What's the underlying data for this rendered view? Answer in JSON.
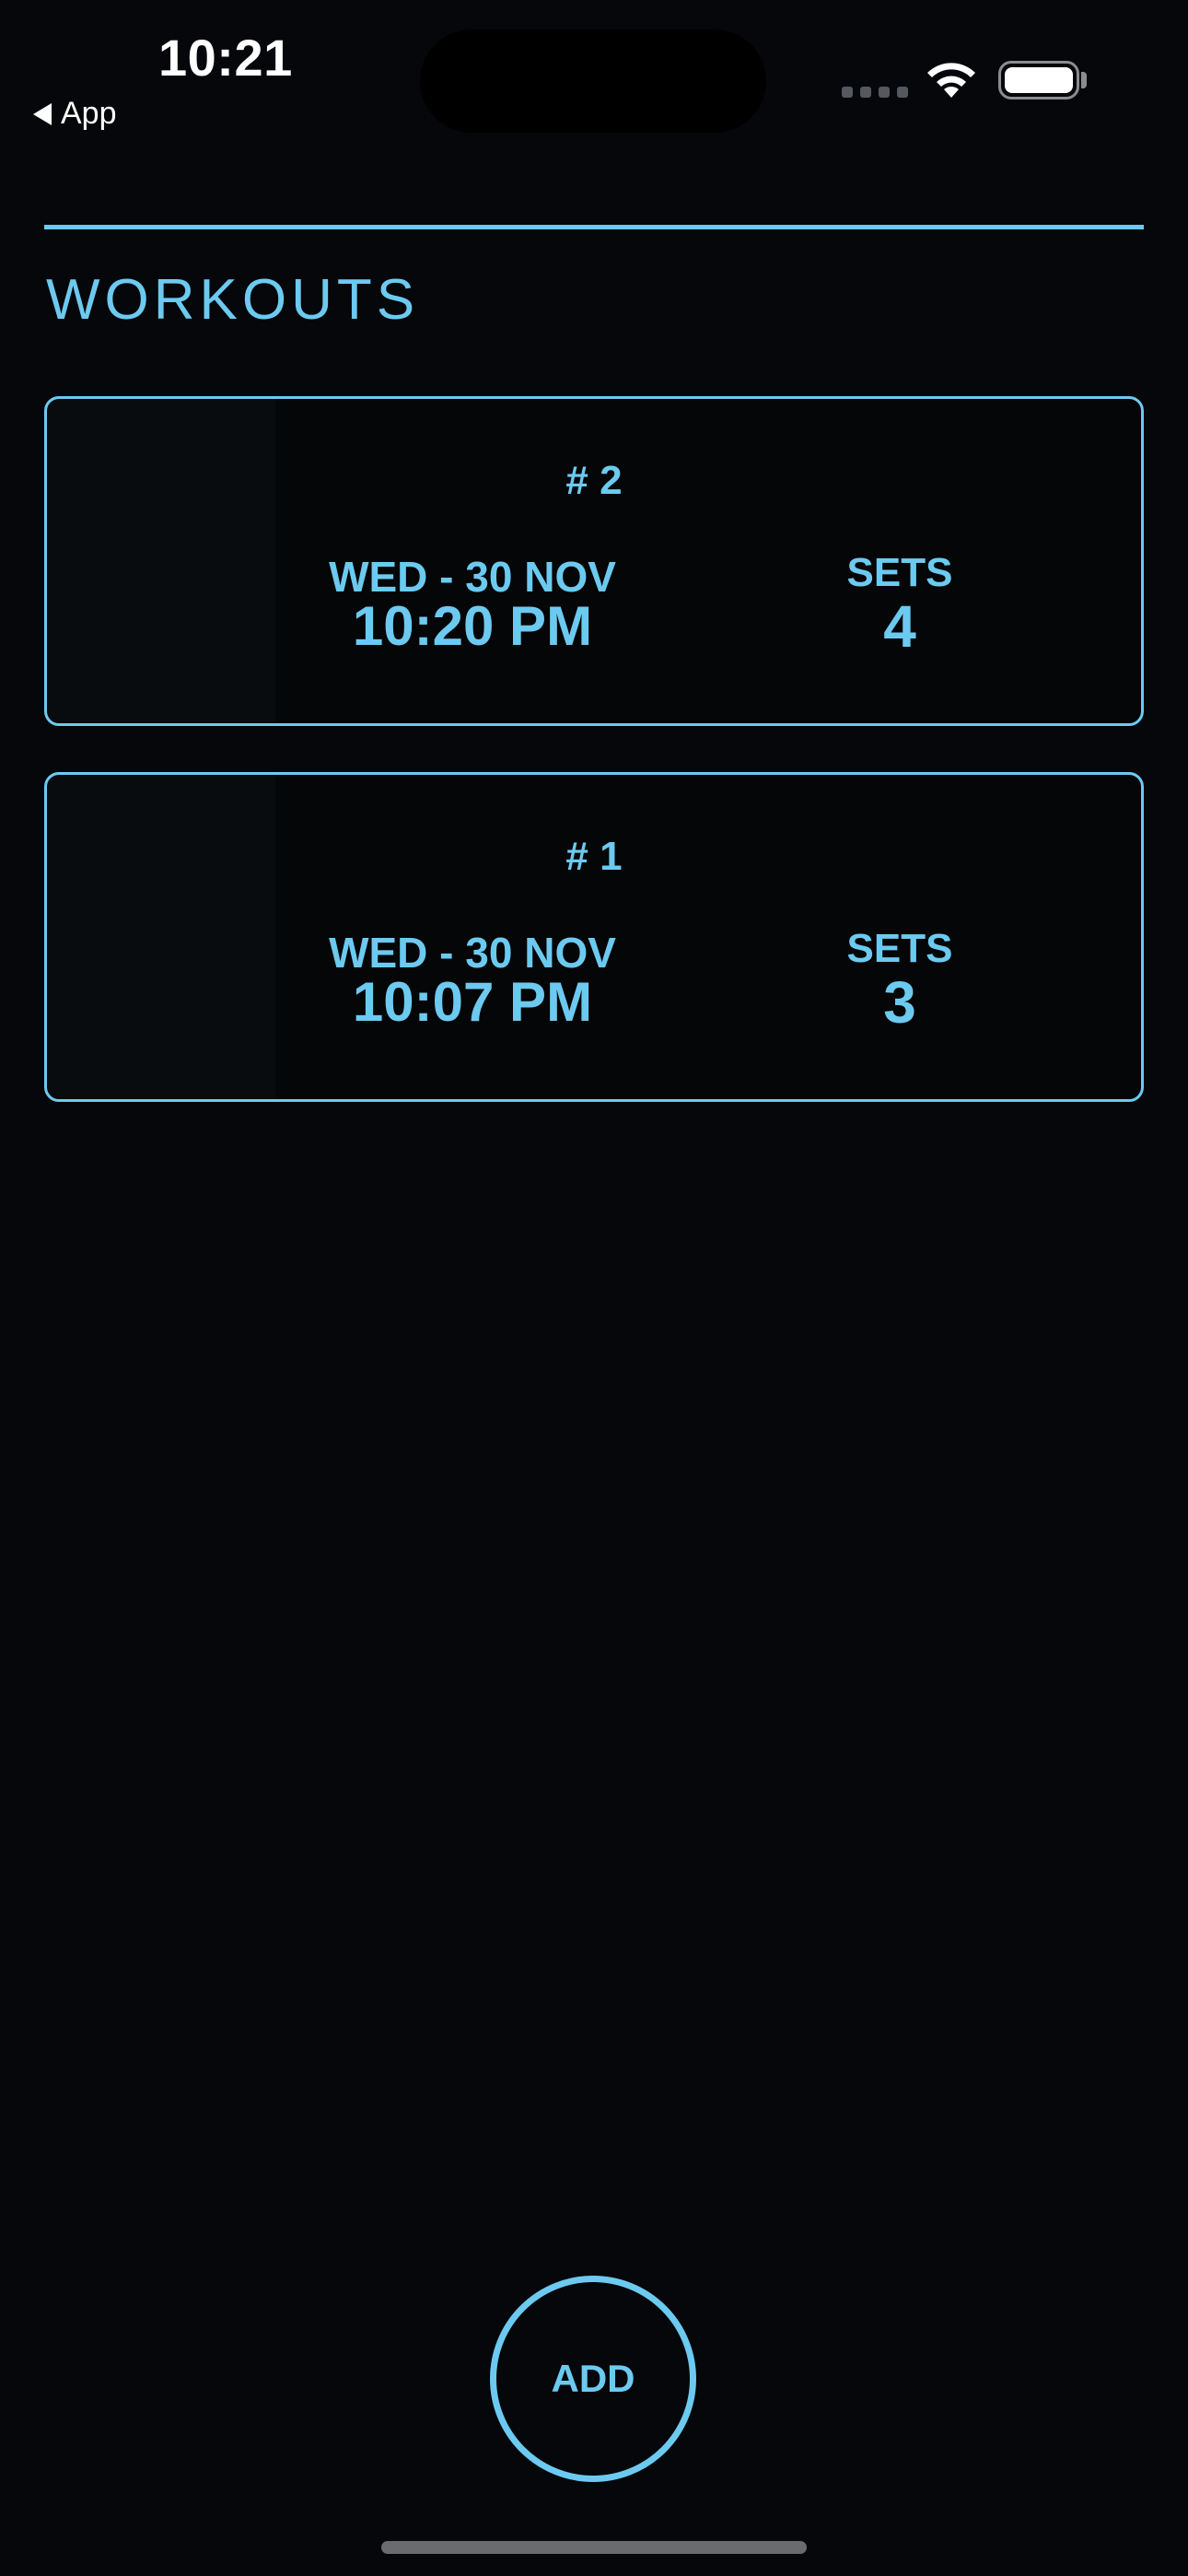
{
  "status_bar": {
    "time": "10:21",
    "back_label": "App"
  },
  "header": {
    "title": "WORKOUTS"
  },
  "workouts": [
    {
      "number": "# 2",
      "date": "WED - 30 NOV",
      "time": "10:20 PM",
      "sets_label": "SETS",
      "sets": "4"
    },
    {
      "number": "# 1",
      "date": "WED - 30 NOV",
      "time": "10:07 PM",
      "sets_label": "SETS",
      "sets": "3"
    }
  ],
  "actions": {
    "add_label": "ADD"
  },
  "colors": {
    "accent": "#6ccaf0",
    "background": "#05070a"
  }
}
